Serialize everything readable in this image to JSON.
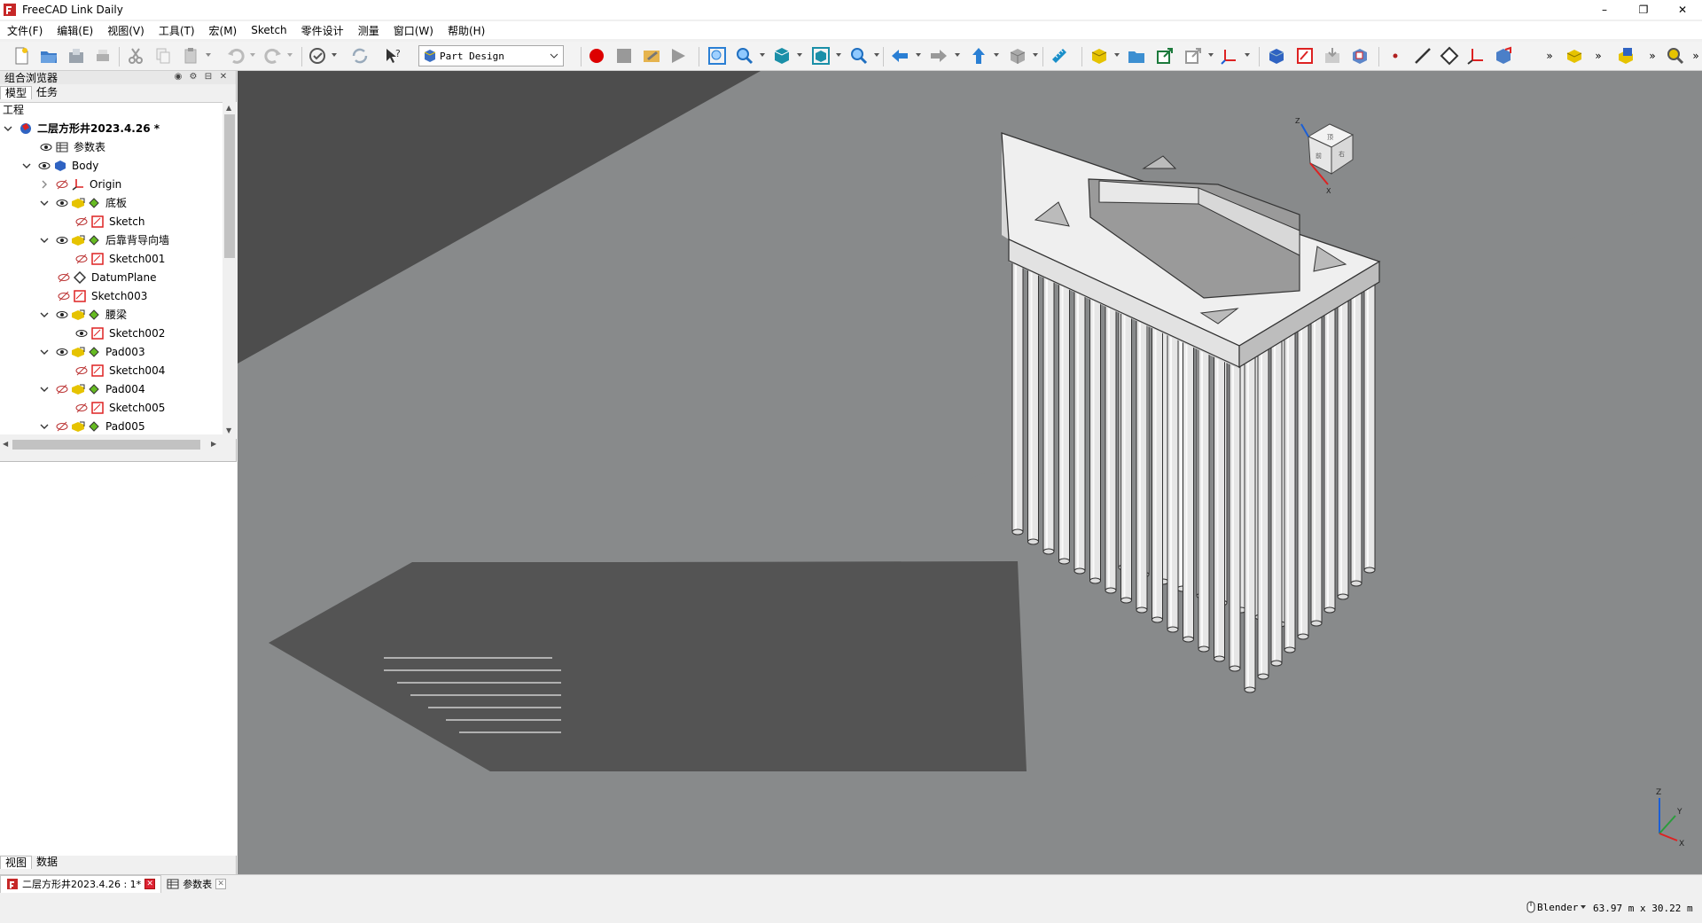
{
  "window": {
    "title": "FreeCAD Link Daily",
    "minimize": "–",
    "restore": "❐",
    "close": "✕"
  },
  "menu": [
    "文件(F)",
    "编辑(E)",
    "视图(V)",
    "工具(T)",
    "宏(M)",
    "Sketch",
    "零件设计",
    "测量",
    "窗口(W)",
    "帮助(H)"
  ],
  "toolbar": {
    "workbench": "Part Design",
    "overflow": "»"
  },
  "panel": {
    "title": "组合浏览器",
    "top_tabs": [
      "模型",
      "任务"
    ],
    "tree_header": "工程",
    "bottom_tabs": [
      "视图",
      "数据"
    ]
  },
  "tree": [
    {
      "label": "二层方形井2023.4.26 *",
      "bold": true
    },
    {
      "label": "参数表"
    },
    {
      "label": "Body"
    },
    {
      "label": "Origin"
    },
    {
      "label": "底板"
    },
    {
      "label": "Sketch"
    },
    {
      "label": "后靠背导向墙"
    },
    {
      "label": "Sketch001"
    },
    {
      "label": "DatumPlane"
    },
    {
      "label": "Sketch003"
    },
    {
      "label": "腰梁"
    },
    {
      "label": "Sketch002"
    },
    {
      "label": "Pad003"
    },
    {
      "label": "Sketch004"
    },
    {
      "label": "Pad004"
    },
    {
      "label": "Sketch005"
    },
    {
      "label": "Pad005"
    }
  ],
  "viewcube": {
    "top": "顶",
    "front": "前",
    "right": "右",
    "z": "Z",
    "x": "X"
  },
  "axis": {
    "z": "Z",
    "y": "Y",
    "x": "X"
  },
  "doc_tabs": [
    {
      "label": "二层方形井2023.4.26 : 1*"
    },
    {
      "label": "参数表"
    }
  ],
  "status": {
    "nav_style": "Blender",
    "dimensions": "63.97 m x 30.22 m"
  },
  "colors": {
    "viewport_bg": "#888a8b",
    "ground": "#585858",
    "floor_dark": "#4a4a4a",
    "model": "#e8e8e8"
  }
}
